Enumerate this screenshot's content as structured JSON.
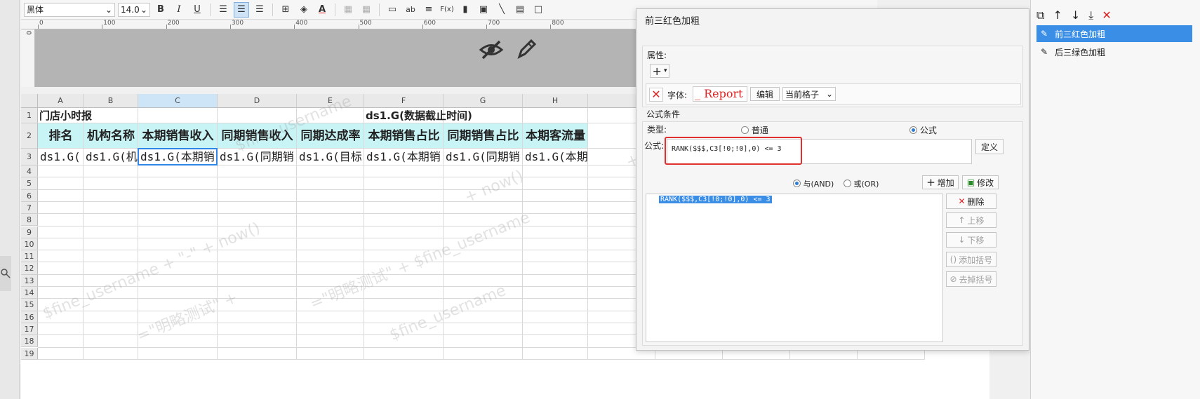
{
  "toolbar": {
    "font_name": "黑体",
    "font_size": "14.0",
    "bold_icon": "B",
    "italic_icon": "I",
    "underline_icon": "U",
    "text_icon": "ab",
    "fx_icon": "F(x)"
  },
  "ruler": {
    "h_ticks": [
      "0",
      "100",
      "200",
      "300",
      "400",
      "500",
      "600",
      "700",
      "800"
    ],
    "v_tick": "0"
  },
  "grid": {
    "columns": [
      "A",
      "B",
      "C",
      "D",
      "E",
      "F",
      "G",
      "H"
    ],
    "rows": [
      "1",
      "2",
      "3",
      "4",
      "5",
      "6",
      "7",
      "8",
      "9",
      "10",
      "11",
      "12",
      "13",
      "14",
      "15",
      "16",
      "17",
      "18",
      "19"
    ],
    "title_left": "门店小时报",
    "title_right": "ds1.G(数据截止时间)",
    "headers": [
      "排名",
      "机构名称",
      "本期销售收入",
      "同期销售收入",
      "同期达成率",
      "本期销售占比",
      "同期销售占比",
      "本期客流量"
    ],
    "row3": [
      "ds1.G(",
      "ds1.G(机",
      "ds1.G(本期销",
      "ds1.G(同期销",
      "ds1.G(目标",
      "ds1.G(本期销",
      "ds1.G(同期销",
      "ds1.G(本期"
    ],
    "watermarks": [
      "$fine_username",
      "+ now()",
      "$fine_username + \"-\" + now()",
      "=\"明略测试\" + $fine_username",
      "=\"明略测试\" +"
    ]
  },
  "dialog": {
    "title": "前三红色加粗",
    "properties_label": "属性:",
    "add_symbol": "+",
    "font_label": "字体:",
    "font_sample": "_ Report",
    "edit_button": "编辑",
    "scope_select": "当前格子",
    "conditions_label": "公式条件",
    "type_label": "类型:",
    "type_normal": "普通",
    "type_formula": "公式",
    "formula_label": "公式:",
    "formula_value": "RANK($$$,C3[!0;!0],0) <= 3",
    "define_button": "定义",
    "and_label": "与(AND)",
    "or_label": "或(OR)",
    "add_button": "增加",
    "modify_button": "修改",
    "condition_item": "RANK($$$,C3[!0;!0],0) <= 3",
    "delete_button": "删除",
    "up_button": "上移",
    "down_button": "下移",
    "add_bracket_button": "添加括号",
    "remove_bracket_button": "去掉括号"
  },
  "right_panel": {
    "items": [
      "前三红色加粗",
      "后三绿色加粗"
    ],
    "selected_index": 0
  },
  "colors": {
    "accent": "#3a8ee6",
    "header_fill": "#c9f4f6",
    "highlight_red": "#e03030",
    "selection_blue": "#2f86e6"
  }
}
